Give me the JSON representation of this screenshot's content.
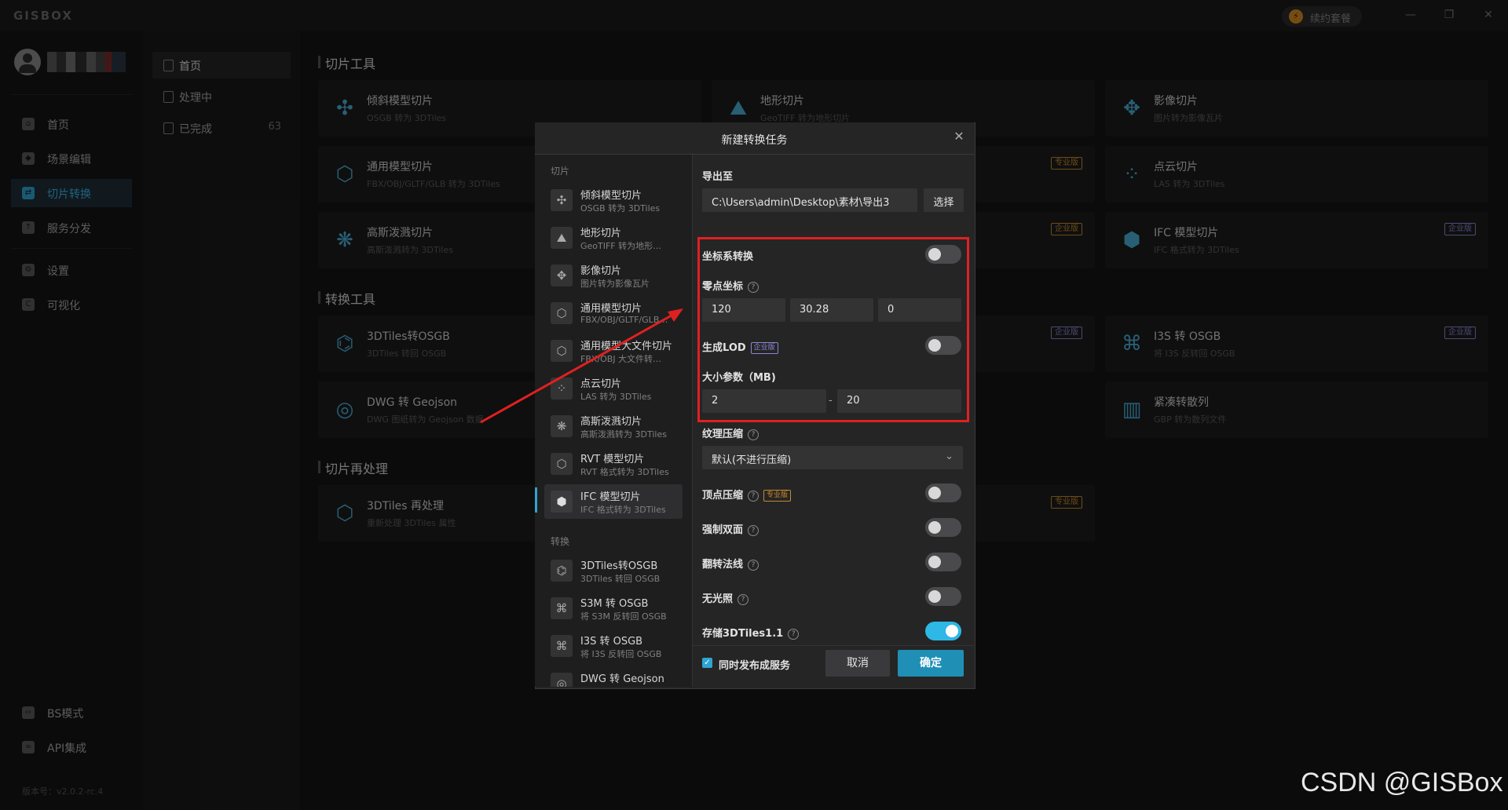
{
  "app": {
    "logo": "GISBOX",
    "renew_label": "续约套餐",
    "window_controls": [
      "—",
      "❐",
      "✕"
    ],
    "version": "版本号：v2.0.2-rc.4"
  },
  "nav": {
    "items": [
      {
        "label": "首页",
        "icon": "home-icon"
      },
      {
        "label": "场景编辑",
        "icon": "cube-icon"
      },
      {
        "label": "切片转换",
        "icon": "convert-icon",
        "active": true
      },
      {
        "label": "服务分发",
        "icon": "upload-icon"
      },
      {
        "label": "设置",
        "icon": "gear-icon"
      },
      {
        "label": "可视化",
        "icon": "chart-icon"
      }
    ],
    "bottom": [
      {
        "label": "BS模式",
        "icon": "code-icon"
      },
      {
        "label": "API集成",
        "icon": "link-icon"
      }
    ]
  },
  "subnav": {
    "items": [
      {
        "label": "首页",
        "active": true
      },
      {
        "label": "处理中",
        "count": ""
      },
      {
        "label": "已完成",
        "count": "63"
      }
    ]
  },
  "main": {
    "sections": [
      "切片工具",
      "转换工具",
      "切片再处理"
    ],
    "cards": [
      {
        "title": "倾斜模型切片",
        "sub": "OSGB 转为 3DTiles",
        "badge": ""
      },
      {
        "title": "地形切片",
        "sub": "GeoTIFF 转为地形切片",
        "badge": ""
      },
      {
        "title": "影像切片",
        "sub": "图片转为影像瓦片",
        "badge": ""
      },
      {
        "title": "通用模型切片",
        "sub": "FBX/OBJ/GLTF/GLB 转为 3DTiles",
        "badge": "专业版"
      },
      {
        "title": "点云切片",
        "sub": "LAS 转为 3DTiles",
        "badge": ""
      },
      {
        "title": "高斯泼溅切片",
        "sub": "高斯泼溅转为 3DTiles",
        "badge": "企业版"
      },
      {
        "title": "IFC 模型切片",
        "sub": "IFC 格式转为 3DTiles",
        "badge": "企业版"
      },
      {
        "title": "3DTiles转OSGB",
        "sub": "3DTiles 转回 OSGB",
        "badge": "企业版"
      },
      {
        "title": "I3S 转 OSGB",
        "sub": "将 I3S 反转回 OSGB",
        "badge": "企业版"
      },
      {
        "title": "DWG 转 Geojson",
        "sub": "DWG 图纸转为 Geojson 数据",
        "badge": ""
      },
      {
        "title": "紧凑转散列",
        "sub": "GBP 转为散列文件",
        "badge": ""
      },
      {
        "title": "3DTiles 再处理",
        "sub": "重新处理 3DTiles 属性",
        "badge": "专业版"
      }
    ],
    "badge_pro": "专业版",
    "badge_ent": "企业版"
  },
  "dialog": {
    "title": "新建转换任务",
    "groups": [
      "切片",
      "转换"
    ],
    "list": [
      {
        "title": "倾斜模型切片",
        "sub": "OSGB 转为 3DTiles"
      },
      {
        "title": "地形切片",
        "sub": "GeoTIFF 转为地形…"
      },
      {
        "title": "影像切片",
        "sub": "图片转为影像瓦片"
      },
      {
        "title": "通用模型切片",
        "sub": "FBX/OBJ/GLTF/GLB…"
      },
      {
        "title": "通用模型大文件切片",
        "sub": "FBX/OBJ 大文件转…"
      },
      {
        "title": "点云切片",
        "sub": "LAS 转为 3DTiles"
      },
      {
        "title": "高斯泼溅切片",
        "sub": "高斯泼溅转为 3DTiles"
      },
      {
        "title": "RVT 模型切片",
        "sub": "RVT 格式转为 3DTiles"
      },
      {
        "title": "IFC 模型切片",
        "sub": "IFC 格式转为 3DTiles",
        "active": true
      },
      {
        "title": "3DTiles转OSGB",
        "sub": "3DTiles 转回 OSGB"
      },
      {
        "title": "S3M 转 OSGB",
        "sub": "将 S3M 反转回 OSGB"
      },
      {
        "title": "I3S 转 OSGB",
        "sub": "将 I3S 反转回 OSGB"
      },
      {
        "title": "DWG 转 Geojson",
        "sub": ""
      }
    ],
    "form": {
      "export_label": "导出至",
      "export_path": "C:\\Users\\admin\\Desktop\\素材\\导出3",
      "choose_button": "选择",
      "coord_transform": "坐标系转换",
      "origin_label": "零点坐标",
      "origin": [
        "120",
        "30.28",
        "0"
      ],
      "lod_label": "生成LOD",
      "size_label": "大小参数（MB)",
      "size_min": "2",
      "size_dash": "-",
      "size_max": "20",
      "texture_label": "纹理压缩",
      "texture_value": "默认(不进行压缩)",
      "vertex_label": "顶点压缩",
      "double_label": "强制双面",
      "flip_label": "翻转法线",
      "unlit_label": "无光照",
      "store_label": "存储3DTiles1.1",
      "publish_label": "同时发布成服务",
      "cancel": "取消",
      "ok": "确定"
    }
  },
  "watermark": "CSDN @GISBox"
}
